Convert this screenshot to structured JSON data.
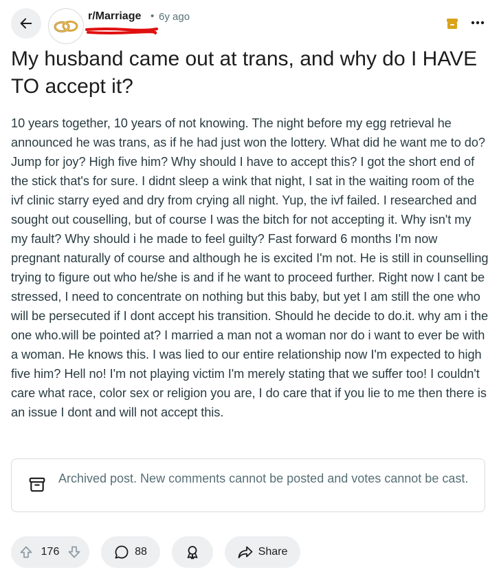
{
  "header": {
    "subreddit": "r/Marriage",
    "separator": "•",
    "age": "6y ago",
    "back_icon": "arrow-left-icon",
    "avatar_icon": "wedding-rings-icon",
    "archive_icon": "archive-badge-icon",
    "more_icon": "more-options-icon"
  },
  "post": {
    "title": "My husband came out at trans, and why do I HAVE TO accept it?",
    "body": "10 years together, 10 years of not knowing. The night before my egg retrieval he announced he was trans, as if he had just won the lottery. What did he want me to do? Jump for joy? High five him? Why should I have to accept this? I got the short end of the stick that's for sure. I didnt sleep a wink that night, I sat in the waiting room of the ivf clinic starry eyed and dry from crying all night. Yup, the ivf failed. I researched and sought out couselling, but of course I was the bitch for not accepting it. Why isn't my my fault? Why should i he made to feel guilty? Fast forward 6 months I'm now pregnant naturally of course and although he is excited I'm not. He is still in counselling trying to figure out who he/she is and if he want to proceed further. Right now I cant be stressed, I need to concentrate on nothing but this baby, but yet I am still the one who will be persecuted if I dont accept his transition. Should he decide to do.it. why am i the one who.will be pointed at? I married a man not a woman nor do i want to ever be with a woman. He knows this. I was lied to our entire relationship now I'm expected to high five him? Hell no! I'm not playing victim I'm merely stating that we suffer too! I couldn't care what race, color sex or religion you are, I do care that if you lie to me then there is an issue I dont and will not accept this."
  },
  "archived": {
    "text": "Archived post. New comments cannot be posted and votes cannot be cast.",
    "icon": "archive-box-icon"
  },
  "actions": {
    "votes": "176",
    "comments": "88",
    "share_label": "Share",
    "upvote_icon": "upvote-arrow-icon",
    "downvote_icon": "downvote-arrow-icon",
    "comment_icon": "comment-bubble-icon",
    "award_icon": "award-icon",
    "share_icon": "share-arrow-icon"
  },
  "colors": {
    "redaction": "#e01010",
    "archive_badge": "#d9a31a",
    "pill_bg": "#edeff1",
    "muted_text": "#576f76"
  }
}
